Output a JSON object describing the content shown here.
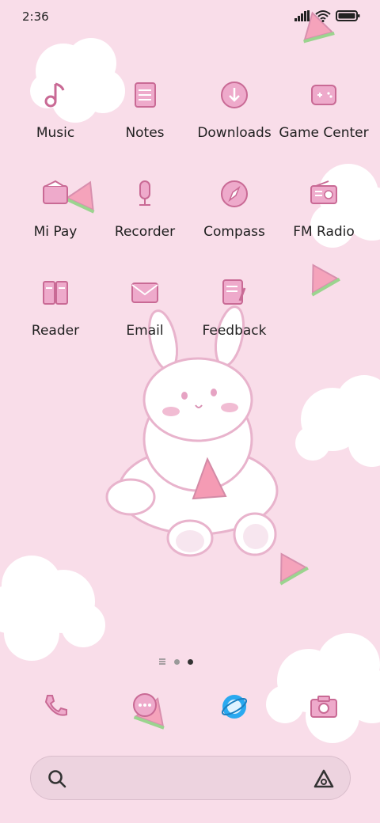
{
  "status_bar": {
    "time": "2:36",
    "icons": [
      "signal-icon",
      "wifi-icon",
      "battery-icon"
    ]
  },
  "colors": {
    "background": "#f9dde9",
    "icon_fill": "#eeaacb",
    "icon_stroke": "#c96a95",
    "browser_blue": "#2aa9f0"
  },
  "apps": [
    {
      "label": "Music",
      "icon": "music-note-icon"
    },
    {
      "label": "Notes",
      "icon": "notes-icon"
    },
    {
      "label": "Downloads",
      "icon": "download-icon"
    },
    {
      "label": "Game Center",
      "icon": "gamepad-icon"
    },
    {
      "label": "Mi Pay",
      "icon": "wallet-icon"
    },
    {
      "label": "Recorder",
      "icon": "microphone-icon"
    },
    {
      "label": "Compass",
      "icon": "compass-icon"
    },
    {
      "label": "FM Radio",
      "icon": "radio-icon"
    },
    {
      "label": "Reader",
      "icon": "book-icon"
    },
    {
      "label": "Email",
      "icon": "envelope-icon"
    },
    {
      "label": "Feedback",
      "icon": "feedback-icon"
    }
  ],
  "page_indicator": {
    "pages": 2,
    "current_page": 2,
    "has_feed_page": true
  },
  "dock": [
    {
      "icon": "phone-icon"
    },
    {
      "icon": "messages-icon"
    },
    {
      "icon": "browser-icon"
    },
    {
      "icon": "camera-icon"
    }
  ],
  "search": {
    "icon": "search-icon",
    "assistant_icon": "assistant-icon"
  }
}
